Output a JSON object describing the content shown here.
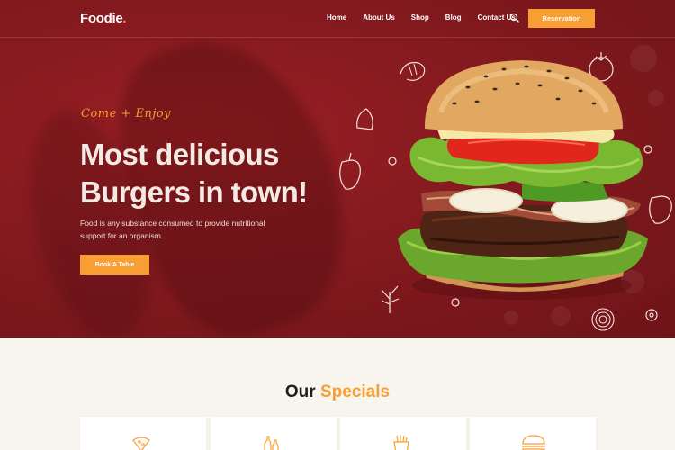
{
  "nav": {
    "logo_text": "Foodie",
    "logo_dot": ".",
    "links": [
      "Home",
      "About Us",
      "Shop",
      "Blog",
      "Contact Us"
    ],
    "reservation_label": "Reservation"
  },
  "hero": {
    "kicker": "Come + Enjoy",
    "headline_line1": "Most delicious",
    "headline_line2": "Burgers in town!",
    "description": "Food is any substance consumed to provide nutritional support for an organism.",
    "cta_label": "Book A Table"
  },
  "specials": {
    "title_part1": "Our ",
    "title_part2": "Specials",
    "cards": [
      {
        "icon": "pizza-icon"
      },
      {
        "icon": "bottles-icon"
      },
      {
        "icon": "fries-icon"
      },
      {
        "icon": "burger-icon"
      }
    ]
  },
  "colors": {
    "hero_red": "#841a1f",
    "accent_orange": "#f99e33",
    "cream_bg": "#f8f4ee"
  }
}
